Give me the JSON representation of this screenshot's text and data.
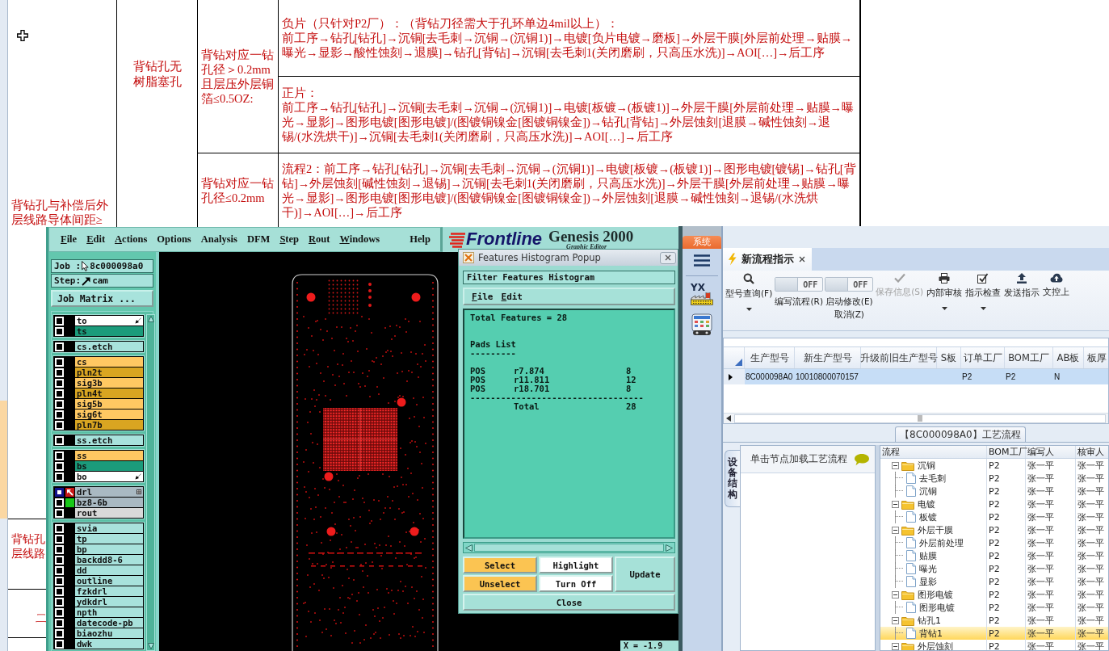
{
  "spreadsheet": {
    "category": "背钻孔与补偿后外层线路导体间距≥",
    "type": "背钻孔无树脂塞孔",
    "conditions": [
      {
        "text": "背钻对应一钻孔径＞0.2mm且层压外层铜箔≤0.5OZ:",
        "flows": [
          {
            "lines": [
              "负片（只针对P2厂）：（背钻刀径需大于孔环单边4mil以上）：",
              "前工序→钻孔[钻孔]→沉铜[去毛刺→沉铜→(沉铜1)]→电镀[负片电镀→磨板]→外层干膜[外层前处理→贴膜→曝光→显影→酸性蚀刻→退膜]→钻孔[背钻]→沉铜[去毛刺1(关闭磨刷，只高压水洗)]→AOI[…]→后工序"
            ]
          },
          {
            "lines": [
              "正片：",
              "前工序→钻孔[钻孔]→沉铜[去毛刺→沉铜→(沉铜1)]→电镀[板镀→(板镀1)]→外层干膜[外层前处理→贴膜→曝光→显影]→图形电镀[图形电镀]/(图镀铜镍金[图镀铜镍金])→钻孔[背钻]→外层蚀刻[退膜→碱性蚀刻→退锡/(水洗烘干)]→沉铜[去毛刺1(关闭磨刷，只高压水洗)]→AOI[…]→后工序"
            ]
          }
        ]
      },
      {
        "text": "背钻对应一钻孔径≤0.2mm",
        "flows": [
          {
            "lines": [
              "流程2：前工序→钻孔[钻孔]→沉铜[去毛刺→沉铜→(沉铜1)]→电镀[板镀→(板镀1)]→图形电镀[镀锡]→钻孔[背钻]→外层蚀刻[碱性蚀刻→退锡]→沉铜[去毛刺1(关闭磨刷，只高压水洗)]→外层干膜[外层前处理→贴膜→曝光→显影]→图形电镀[图形电镀]/(图镀铜镍金[图镀铜镍金])→外层蚀刻[退膜→碱性蚀刻→退锡/(水洗烘干)]→AOI[…]→后工序"
            ]
          }
        ]
      }
    ],
    "lower_cells": [
      {
        "lines": [
          "背钻孔",
          "层线路"
        ]
      },
      {
        "lines": [
          "二"
        ]
      }
    ]
  },
  "genesis": {
    "menu": [
      {
        "label": "File",
        "underline": true
      },
      {
        "label": "Edit",
        "underline": true
      },
      {
        "label": "Actions",
        "underline": true
      },
      {
        "label": "Options",
        "underline": false
      },
      {
        "label": "Analysis",
        "underline": false
      },
      {
        "label": "DFM",
        "underline": false
      },
      {
        "label": "Step",
        "underline": true
      },
      {
        "label": "Rout",
        "underline": true
      },
      {
        "label": "Windows",
        "underline": true
      },
      {
        "label": "Help",
        "underline": false
      }
    ],
    "logo": "Frontline",
    "product": "Genesis 2000",
    "subtitle": "Graphic Editor",
    "job": {
      "label": "Job :",
      "value": "8c000098a0"
    },
    "step": {
      "label": "Step:",
      "value": "cam"
    },
    "job_matrix": "Job Matrix ...",
    "layer_groups": [
      {
        "layers": [
          {
            "name": "to",
            "color": "#ffffff",
            "kind": "pointer",
            "affected": false,
            "work_layer": false,
            "displayed": false
          },
          {
            "name": "ts",
            "color": "#1b9b7b",
            "kind": "plain",
            "affected": false,
            "work_layer": false,
            "displayed": false
          }
        ]
      },
      {
        "layers": [
          {
            "name": "cs.etch",
            "color": "#a8e2dc",
            "kind": "plain",
            "affected": false,
            "work_layer": false,
            "displayed": false
          }
        ]
      },
      {
        "layers": [
          {
            "name": "cs",
            "color": "#ffc862",
            "kind": "plain",
            "affected": false,
            "work_layer": false,
            "displayed": false
          },
          {
            "name": "pln2t",
            "color": "#d9a521",
            "kind": "plain",
            "affected": false,
            "work_layer": false,
            "displayed": false
          },
          {
            "name": "sig3b",
            "color": "#ffc862",
            "kind": "plain",
            "affected": false,
            "work_layer": false,
            "displayed": false
          },
          {
            "name": "pln4t",
            "color": "#d9a521",
            "kind": "plain",
            "affected": false,
            "work_layer": false,
            "displayed": false
          },
          {
            "name": "sig5b",
            "color": "#ffc862",
            "kind": "plain",
            "affected": false,
            "work_layer": false,
            "displayed": false
          },
          {
            "name": "sig6t",
            "color": "#ffc862",
            "kind": "plain",
            "affected": false,
            "work_layer": false,
            "displayed": false
          },
          {
            "name": "pln7b",
            "color": "#d9a521",
            "kind": "plain",
            "affected": false,
            "work_layer": false,
            "displayed": false
          }
        ]
      },
      {
        "layers": [
          {
            "name": "ss.etch",
            "color": "#a8e2dc",
            "kind": "plain",
            "affected": false,
            "work_layer": false,
            "displayed": false
          }
        ]
      },
      {
        "layers": [
          {
            "name": "ss",
            "color": "#ffc862",
            "kind": "plain",
            "affected": false,
            "work_layer": false,
            "displayed": false
          },
          {
            "name": "bs",
            "color": "#1b9b7b",
            "kind": "plain",
            "affected": false,
            "work_layer": false,
            "displayed": false
          },
          {
            "name": "bo",
            "color": "#ffffff",
            "kind": "pointer",
            "affected": false,
            "work_layer": false,
            "displayed": false
          }
        ]
      },
      {
        "layers": [
          {
            "name": "drl",
            "color": "#a9b9c2",
            "kind": "grid",
            "affected": true,
            "work_layer": true,
            "displayed": false
          },
          {
            "name": "bz8-6b",
            "color": "#a9b9c2",
            "kind": "plain",
            "affected": false,
            "work_layer": false,
            "displayed": true
          },
          {
            "name": "rout",
            "color": "#d9d9d9",
            "kind": "plain",
            "affected": false,
            "work_layer": false,
            "displayed": false
          }
        ]
      },
      {
        "layers": [
          {
            "name": "svia",
            "color": "#a8e2dc",
            "kind": "plain",
            "affected": false,
            "work_layer": false,
            "displayed": false
          },
          {
            "name": "tp",
            "color": "#a8e2dc",
            "kind": "plain",
            "affected": false,
            "work_layer": false,
            "displayed": false
          },
          {
            "name": "bp",
            "color": "#a8e2dc",
            "kind": "plain",
            "affected": false,
            "work_layer": false,
            "displayed": false
          },
          {
            "name": "backdd8-6",
            "color": "#a8e2dc",
            "kind": "plain",
            "affected": false,
            "work_layer": false,
            "displayed": false
          },
          {
            "name": "dd",
            "color": "#a8e2dc",
            "kind": "plain",
            "affected": false,
            "work_layer": false,
            "displayed": false
          },
          {
            "name": "outline",
            "color": "#a8e2dc",
            "kind": "plain",
            "affected": false,
            "work_layer": false,
            "displayed": false
          },
          {
            "name": "fzkdrl",
            "color": "#a8e2dc",
            "kind": "plain",
            "affected": false,
            "work_layer": false,
            "displayed": false
          },
          {
            "name": "ydkdrl",
            "color": "#a8e2dc",
            "kind": "plain",
            "affected": false,
            "work_layer": false,
            "displayed": false
          },
          {
            "name": "npth",
            "color": "#a8e2dc",
            "kind": "plain",
            "affected": false,
            "work_layer": false,
            "displayed": false
          },
          {
            "name": "datecode-pb",
            "color": "#a8e2dc",
            "kind": "plain",
            "affected": false,
            "work_layer": false,
            "displayed": false
          },
          {
            "name": "biaozhu",
            "color": "#a8e2dc",
            "kind": "plain",
            "affected": false,
            "work_layer": false,
            "displayed": false
          },
          {
            "name": "dwk",
            "color": "#a8e2dc",
            "kind": "plain",
            "affected": false,
            "work_layer": false,
            "displayed": false
          }
        ]
      }
    ],
    "readout": "X = -1.9"
  },
  "histogram_popup": {
    "title": "Features Histogram Popup",
    "filter_label": "Filter Features Histogram",
    "menu": [
      {
        "label": "File",
        "underline": true
      },
      {
        "label": "Edit",
        "underline": true
      }
    ],
    "summary": "Total Features = 28",
    "list_title": "Pads List",
    "list_rule": "---------",
    "rows": [
      {
        "type": "POS",
        "symbol": "r7.874",
        "count": "8"
      },
      {
        "type": "POS",
        "symbol": "r11.811",
        "count": "12"
      },
      {
        "type": "POS",
        "symbol": "r18.701",
        "count": "8"
      }
    ],
    "total_rule": "----------------------------------",
    "total": {
      "label": "Total",
      "count": "28"
    },
    "buttons": [
      {
        "label": "Select",
        "kind": "select"
      },
      {
        "label": "Highlight",
        "kind": "display"
      },
      {
        "label": "Update",
        "kind": "update"
      },
      {
        "label": "Unselect",
        "kind": "select"
      },
      {
        "label": "Turn Off",
        "kind": "display"
      },
      {
        "label": "Close",
        "kind": "close"
      }
    ]
  },
  "erp": {
    "system_tab": "系统",
    "sidebar": {
      "logo_text": "YX"
    },
    "tabs": [
      {
        "label": "新流程指示",
        "selected": true
      }
    ],
    "toolbar": [
      {
        "kind": "button",
        "label": "型号查询(F)",
        "dropdown": true,
        "disabled": false
      },
      {
        "kind": "toggle",
        "label": "编写流程(R)",
        "switch_text": "OFF",
        "on": false,
        "dropdown": false,
        "disabled": false
      },
      {
        "kind": "toggle",
        "label": "启动修改(E)",
        "sublabel": "取消(Z)",
        "switch_text": "OFF",
        "on": false,
        "dropdown": false,
        "disabled": false
      },
      {
        "kind": "button",
        "label": "保存信息(S)",
        "dropdown": false,
        "disabled": true
      },
      {
        "kind": "button",
        "label": "内部审核",
        "dropdown": true,
        "disabled": false
      },
      {
        "kind": "button",
        "label": "指示检查",
        "dropdown": true,
        "disabled": false
      },
      {
        "kind": "button",
        "label": "发送指示",
        "dropdown": false,
        "disabled": false
      },
      {
        "kind": "button",
        "label": "文控上",
        "dropdown": false,
        "disabled": false
      }
    ],
    "grid": {
      "columns": [
        "生产型号",
        "新生产型号",
        "升级前旧生产型号",
        "S板",
        "订单工厂",
        "BOM工厂",
        "AB板",
        "板厚"
      ],
      "rows": [
        {
          "selected": true,
          "cells": [
            "8C000098A0",
            "10010800070157",
            null,
            null,
            "P2",
            "P2",
            "N",
            null
          ]
        }
      ]
    },
    "process": {
      "title": "【8C000098A0】工艺流程",
      "side_tab": "设备结构",
      "hint": "单击节点加载工艺流程",
      "tree": {
        "columns": [
          "流程",
          "BOM工厂",
          "编写人",
          "核审人"
        ],
        "nodes": [
          {
            "name": "沉铜",
            "bom_factory": "P2",
            "writer": "张一平",
            "reviewer": "张一平",
            "expanded": true,
            "selected": false,
            "children": [
              {
                "name": "去毛刺",
                "bom_factory": "P2",
                "writer": "张一平",
                "reviewer": "张一平",
                "selected": false
              },
              {
                "name": "沉铜",
                "bom_factory": "P2",
                "writer": "张一平",
                "reviewer": "张一平",
                "selected": false
              }
            ]
          },
          {
            "name": "电镀",
            "bom_factory": "P2",
            "writer": "张一平",
            "reviewer": "张一平",
            "expanded": true,
            "selected": false,
            "children": [
              {
                "name": "板镀",
                "bom_factory": "P2",
                "writer": "张一平",
                "reviewer": "张一平",
                "selected": false
              }
            ]
          },
          {
            "name": "外层干膜",
            "bom_factory": "P2",
            "writer": "张一平",
            "reviewer": "张一平",
            "expanded": true,
            "selected": false,
            "children": [
              {
                "name": "外层前处理",
                "bom_factory": "P2",
                "writer": "张一平",
                "reviewer": "张一平",
                "selected": false
              },
              {
                "name": "贴膜",
                "bom_factory": "P2",
                "writer": "张一平",
                "reviewer": "张一平",
                "selected": false
              },
              {
                "name": "曝光",
                "bom_factory": "P2",
                "writer": "张一平",
                "reviewer": "张一平",
                "selected": false
              },
              {
                "name": "显影",
                "bom_factory": "P2",
                "writer": "张一平",
                "reviewer": "张一平",
                "selected": false
              }
            ]
          },
          {
            "name": "图形电镀",
            "bom_factory": "P2",
            "writer": "张一平",
            "reviewer": "张一平",
            "expanded": true,
            "selected": false,
            "children": [
              {
                "name": "图形电镀",
                "bom_factory": "P2",
                "writer": "张一平",
                "reviewer": "张一平",
                "selected": false
              }
            ]
          },
          {
            "name": "钻孔1",
            "bom_factory": "P2",
            "writer": "张一平",
            "reviewer": "张一平",
            "expanded": true,
            "selected": false,
            "children": [
              {
                "name": "背钻1",
                "bom_factory": "P2",
                "writer": "张一平",
                "reviewer": "张一平",
                "selected": true
              }
            ]
          },
          {
            "name": "外层蚀刻",
            "bom_factory": "P2",
            "writer": "张一平",
            "reviewer": "张一平",
            "expanded": true,
            "selected": false
          }
        ]
      }
    }
  }
}
